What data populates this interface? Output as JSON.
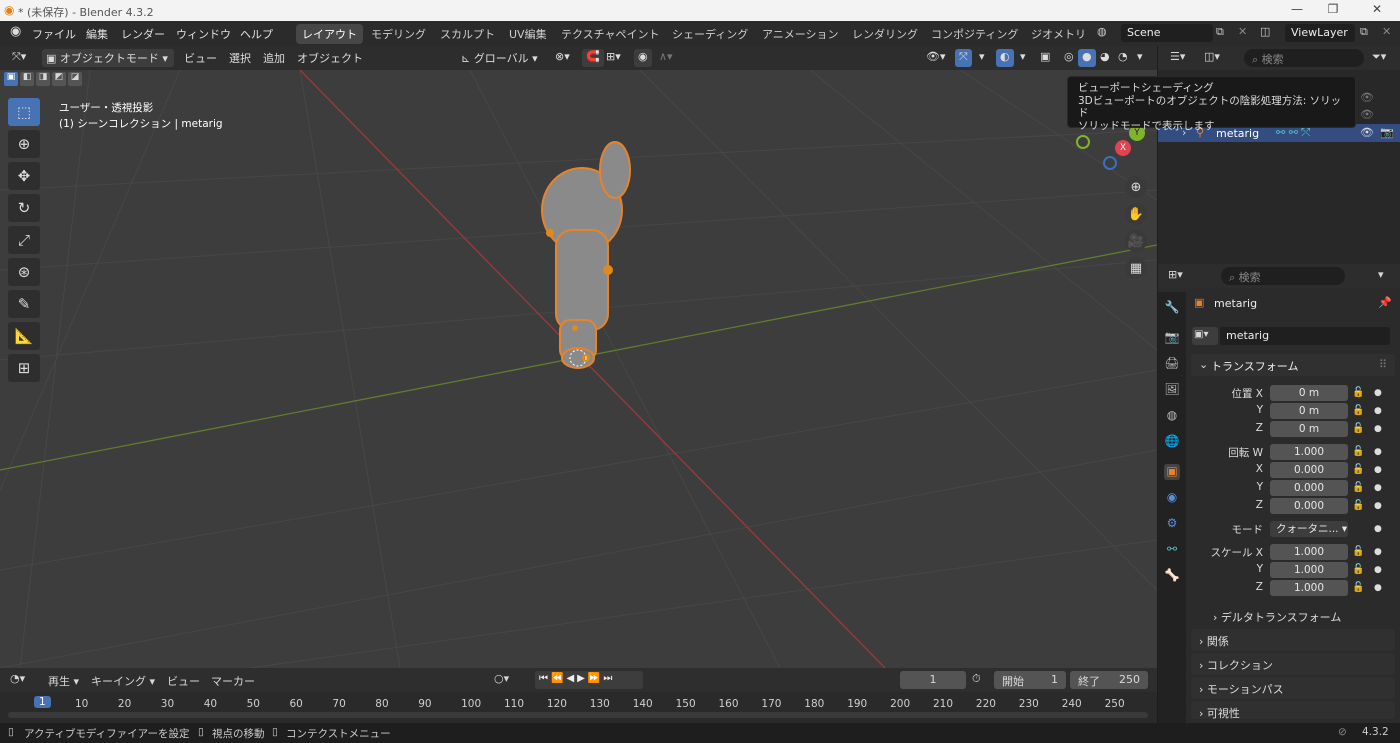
{
  "window": {
    "title": "* (未保存) - Blender 4.3.2",
    "minimize": "—",
    "maximize": "❐",
    "close": "✕"
  },
  "menu": {
    "items": [
      "ファイル",
      "編集",
      "レンダー",
      "ウィンドウ",
      "ヘルプ"
    ]
  },
  "workspaces": [
    "レイアウト",
    "モデリング",
    "スカルプト",
    "UV編集",
    "テクスチャペイント",
    "シェーディング",
    "アニメーション",
    "レンダリング",
    "コンポジティング",
    "ジオメトリ"
  ],
  "scene": {
    "name": "Scene",
    "view_layer": "ViewLayer"
  },
  "viewport_header": {
    "mode": "オブジェクトモード",
    "view": "ビュー",
    "select": "選択",
    "add": "追加",
    "object": "オブジェクト",
    "transform_orientation": "グローバル"
  },
  "viewport": {
    "projection": "ユーザー・透視投影",
    "collection": "(1) シーンコレクション | metarig",
    "axis_colors": {
      "x": "#e04450",
      "y": "#7fb52c",
      "z": "#3b6fc4"
    }
  },
  "tooltip": {
    "title": "ビューポートシェーディング",
    "line1": "3Dビューポートのオブジェクトの陰影処理方法: ソリッド",
    "line2": "ソリッドモードで表示します"
  },
  "outliner": {
    "search_placeholder": "検索",
    "row": "metarig"
  },
  "properties": {
    "search_placeholder": "検索",
    "object_name": "metarig",
    "data_name": "metarig",
    "transform_title": "トランスフォーム",
    "location_label": "位置 X",
    "location": [
      "0 m",
      "0 m",
      "0 m"
    ],
    "rotation_label": "回転 W",
    "rotation": [
      "1.000",
      "0.000",
      "0.000",
      "0.000"
    ],
    "mode_label": "モード",
    "mode_value": "クォータニ...",
    "scale_label": "スケール X",
    "scale": [
      "1.000",
      "1.000",
      "1.000"
    ],
    "axis_y": "Y",
    "axis_z": "Z",
    "axis_x": "X",
    "delta": "デルタトランスフォーム",
    "panels": [
      "関係",
      "コレクション",
      "モーションパス",
      "可視性"
    ]
  },
  "timeline": {
    "playback": "再生",
    "keying": "キーイング",
    "view": "ビュー",
    "marker": "マーカー",
    "current_frame": "1",
    "start_label": "開始",
    "start": "1",
    "end_label": "終了",
    "end": "250",
    "ticks": [
      "1",
      "10",
      "20",
      "30",
      "40",
      "50",
      "60",
      "70",
      "80",
      "90",
      "100",
      "110",
      "120",
      "130",
      "140",
      "150",
      "160",
      "170",
      "180",
      "190",
      "200",
      "210",
      "220",
      "230",
      "240",
      "250"
    ]
  },
  "status": {
    "hint1": "アクティブモディファイアーを設定",
    "hint2": "視点の移動",
    "hint3": "コンテクストメニュー",
    "version": "4.3.2"
  }
}
